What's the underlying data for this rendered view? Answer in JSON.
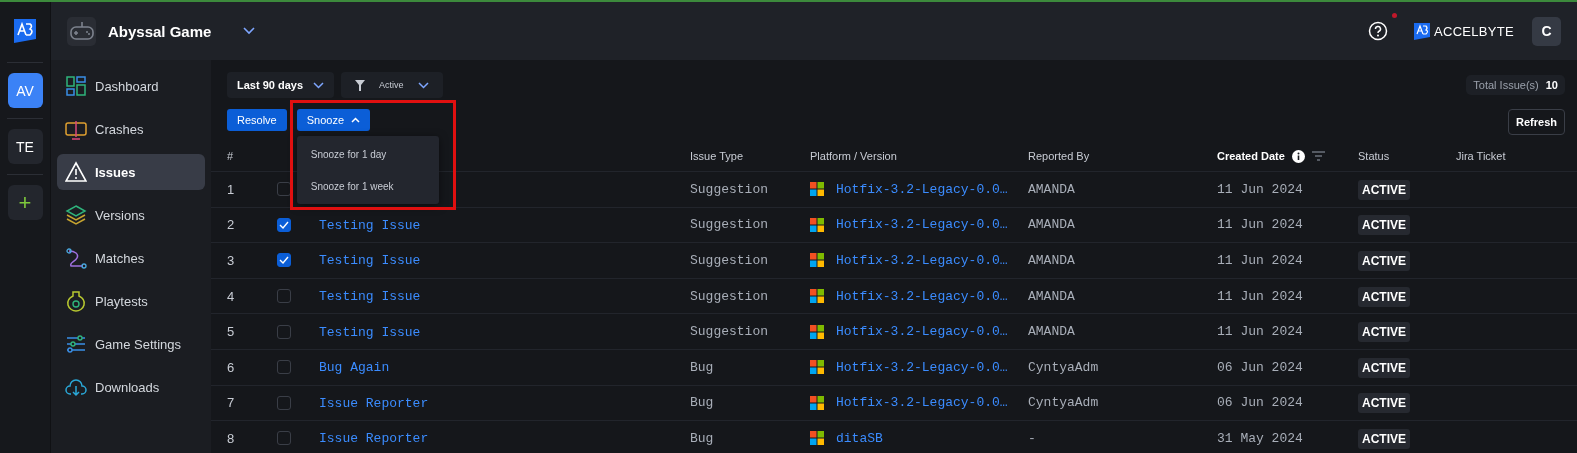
{
  "rail": {
    "items": [
      {
        "label": "AV",
        "selected": true
      },
      {
        "label": "TE",
        "selected": false
      }
    ],
    "add_label": "+"
  },
  "header": {
    "game": "Abyssal Game",
    "brand": "ACCELBYTE",
    "user": "C",
    "notification": true
  },
  "sidebar": {
    "items": [
      {
        "label": "Dashboard",
        "selected": false
      },
      {
        "label": "Crashes",
        "selected": false
      },
      {
        "label": "Issues",
        "selected": true
      },
      {
        "label": "Versions",
        "selected": false
      },
      {
        "label": "Matches",
        "selected": false
      },
      {
        "label": "Playtests",
        "selected": false
      },
      {
        "label": "Game Settings",
        "selected": false
      },
      {
        "label": "Downloads",
        "selected": false
      }
    ]
  },
  "filters": {
    "period": "Last 90 days",
    "status": "Active"
  },
  "total": {
    "label": "Total Issue(s)",
    "value": "10"
  },
  "actions": {
    "resolve": "Resolve",
    "snooze": "Snooze",
    "refresh": "Refresh"
  },
  "snooze_menu": {
    "expanded": true,
    "items": [
      "Snooze for 1 day",
      "Snooze for 1 week"
    ]
  },
  "table": {
    "columns": [
      "#",
      "Issue Type",
      "Platform / Version",
      "Reported By",
      "Created Date",
      "Status",
      "Jira Ticket"
    ],
    "rows": [
      {
        "num": "1",
        "checked": false,
        "type": "Suggestion",
        "platform": "Hotfix-3.2-Legacy-0.0…",
        "reporter": "AMANDA",
        "date": "11 Jun 2024",
        "status": "ACTIVE"
      },
      {
        "num": "2",
        "checked": true,
        "title": "Testing Issue",
        "type": "Suggestion",
        "platform": "Hotfix-3.2-Legacy-0.0…",
        "reporter": "AMANDA",
        "date": "11 Jun 2024",
        "status": "ACTIVE"
      },
      {
        "num": "3",
        "checked": true,
        "title": "Testing Issue",
        "type": "Suggestion",
        "platform": "Hotfix-3.2-Legacy-0.0…",
        "reporter": "AMANDA",
        "date": "11 Jun 2024",
        "status": "ACTIVE"
      },
      {
        "num": "4",
        "checked": false,
        "title": "Testing Issue",
        "type": "Suggestion",
        "platform": "Hotfix-3.2-Legacy-0.0…",
        "reporter": "AMANDA",
        "date": "11 Jun 2024",
        "status": "ACTIVE"
      },
      {
        "num": "5",
        "checked": false,
        "title": "Testing Issue",
        "type": "Suggestion",
        "platform": "Hotfix-3.2-Legacy-0.0…",
        "reporter": "AMANDA",
        "date": "11 Jun 2024",
        "status": "ACTIVE"
      },
      {
        "num": "6",
        "checked": false,
        "title": "Bug Again",
        "type": "Bug",
        "platform": "Hotfix-3.2-Legacy-0.0…",
        "reporter": "CyntyaAdm",
        "date": "06 Jun 2024",
        "status": "ACTIVE"
      },
      {
        "num": "7",
        "checked": false,
        "title": "Issue Reporter",
        "type": "Bug",
        "platform": "Hotfix-3.2-Legacy-0.0…",
        "reporter": "CyntyaAdm",
        "date": "06 Jun 2024",
        "status": "ACTIVE"
      },
      {
        "num": "8",
        "checked": false,
        "title": "Issue Reporter",
        "type": "Bug",
        "platform": "ditaSB",
        "reporter": "-",
        "date": "31 May 2024",
        "status": "ACTIVE"
      }
    ]
  }
}
